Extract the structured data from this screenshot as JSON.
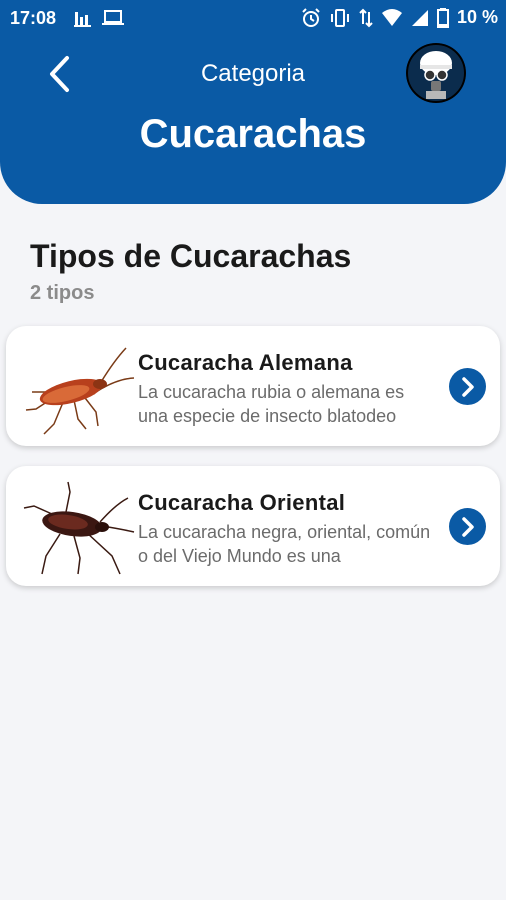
{
  "status_bar": {
    "time": "17:08",
    "battery": "10 %"
  },
  "header": {
    "subtitle": "Categoria",
    "title": "Cucarachas"
  },
  "section": {
    "title": "Tipos de Cucarachas",
    "count": "2 tipos"
  },
  "items": [
    {
      "title": "Cucaracha Alemana",
      "description": "La cucaracha rubia o alemana es una especie de insecto blatodeo"
    },
    {
      "title": "Cucaracha Oriental",
      "description": "La cucaracha negra, oriental, común o del Viejo Mundo es una"
    }
  ],
  "colors": {
    "primary": "#0a5aa5",
    "background": "#f4f5f8"
  }
}
